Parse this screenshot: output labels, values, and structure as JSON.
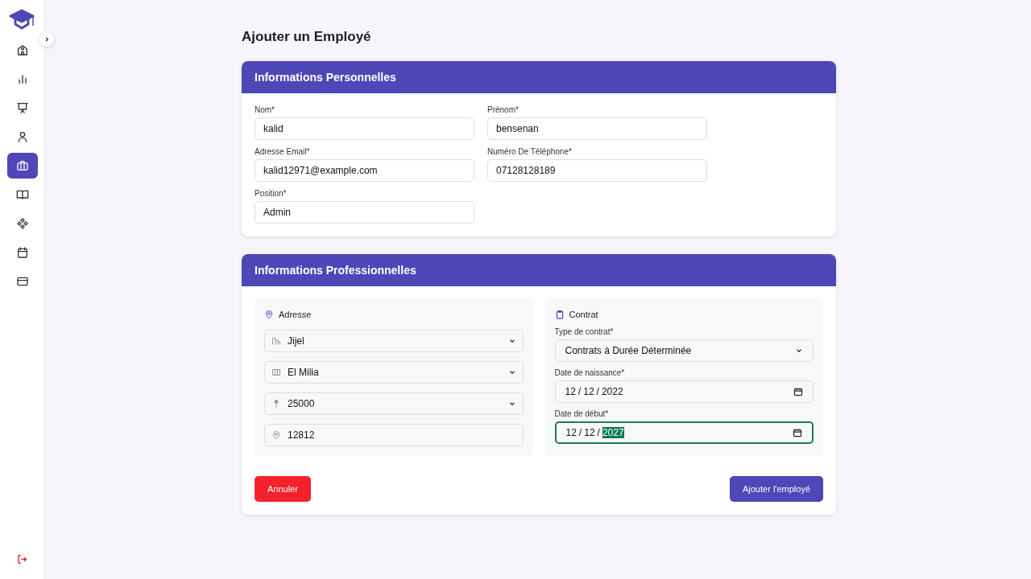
{
  "sidebar": {
    "items": [
      {
        "kind": "building",
        "selected": false
      },
      {
        "kind": "chart",
        "selected": false
      },
      {
        "kind": "presentation",
        "selected": false
      },
      {
        "kind": "user",
        "selected": false
      },
      {
        "kind": "briefcase",
        "selected": true
      },
      {
        "kind": "book",
        "selected": false
      },
      {
        "kind": "components",
        "selected": false
      },
      {
        "kind": "calendar",
        "selected": false
      },
      {
        "kind": "card",
        "selected": false
      }
    ]
  },
  "page_title": "Ajouter un Employé",
  "personal": {
    "title": "Informations Personnelles",
    "fields": [
      {
        "label": "Nom*",
        "value": "kalid"
      },
      {
        "label": "Prénom*",
        "value": "bensenan"
      },
      {
        "label": "Adresse Email*",
        "value": "kalid12971@example.com"
      },
      {
        "label": "Numéro De Téléphone*",
        "value": "07128128189"
      },
      {
        "label": "Position*",
        "value": "Admin"
      }
    ]
  },
  "professional": {
    "title": "Informations Professionnelles",
    "address": {
      "title": "Adresse",
      "fields": [
        {
          "kind": "select",
          "value": "Jijel"
        },
        {
          "kind": "select",
          "value": "El Milia"
        },
        {
          "kind": "select",
          "value": "25000"
        },
        {
          "kind": "input",
          "value": "12812"
        }
      ]
    },
    "contract": {
      "title": "Contrat",
      "fields": [
        {
          "kind": "select",
          "label": "Type de contrat*",
          "value": "Contrats à Durée Déterminée",
          "focused": false
        },
        {
          "kind": "date",
          "label": "Date de naissance*",
          "focused": false,
          "segments": [
            {
              "text": "12",
              "selected": false
            },
            {
              "text": "/",
              "selected": false
            },
            {
              "text": "12",
              "selected": false
            },
            {
              "text": "/",
              "selected": false
            },
            {
              "text": "2022",
              "selected": false
            }
          ]
        },
        {
          "kind": "date",
          "label": "Date de début*",
          "focused": true,
          "segments": [
            {
              "text": "12",
              "selected": false
            },
            {
              "text": "/",
              "selected": false
            },
            {
              "text": "12",
              "selected": false
            },
            {
              "text": "/",
              "selected": false
            },
            {
              "text": "2027",
              "selected": true
            }
          ]
        }
      ]
    }
  },
  "buttons": {
    "cancel": "Annuler",
    "submit": "Ajouter l'employé"
  }
}
